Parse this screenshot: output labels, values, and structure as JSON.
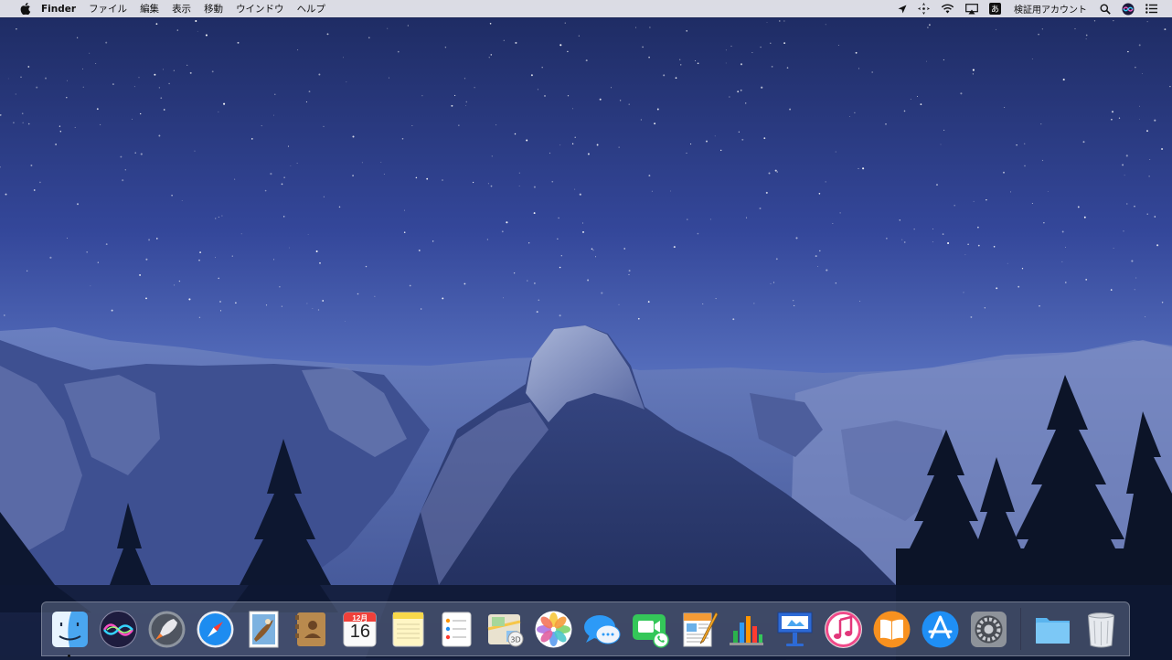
{
  "menubar": {
    "app_name": "Finder",
    "menus": [
      "ファイル",
      "編集",
      "表示",
      "移動",
      "ウインドウ",
      "ヘルプ"
    ],
    "user_name": "検証用アカウント",
    "input_method_glyph": "あ",
    "status_icons": [
      "location-icon",
      "accessibility-icon",
      "wifi-icon",
      "airplay-icon",
      "input-method-icon",
      "spotlight-icon",
      "siri-icon",
      "notification-center-icon"
    ]
  },
  "dock": {
    "apps": [
      "Finder",
      "Siri",
      "Launchpad",
      "Safari",
      "Mail",
      "Contacts",
      "Calendar",
      "Notes",
      "Reminders",
      "Maps",
      "Photos",
      "Messages",
      "FaceTime",
      "Pages",
      "Numbers",
      "Keynote",
      "iTunes",
      "iBooks",
      "App Store",
      "System Preferences"
    ],
    "calendar": {
      "month": "12月",
      "day": "16"
    },
    "right": [
      "Downloads",
      "Trash"
    ]
  },
  "colors": {
    "sky_top": "#1f2d63",
    "sky_bottom": "#6b86cd",
    "menubar_bg": "#ececf0"
  }
}
